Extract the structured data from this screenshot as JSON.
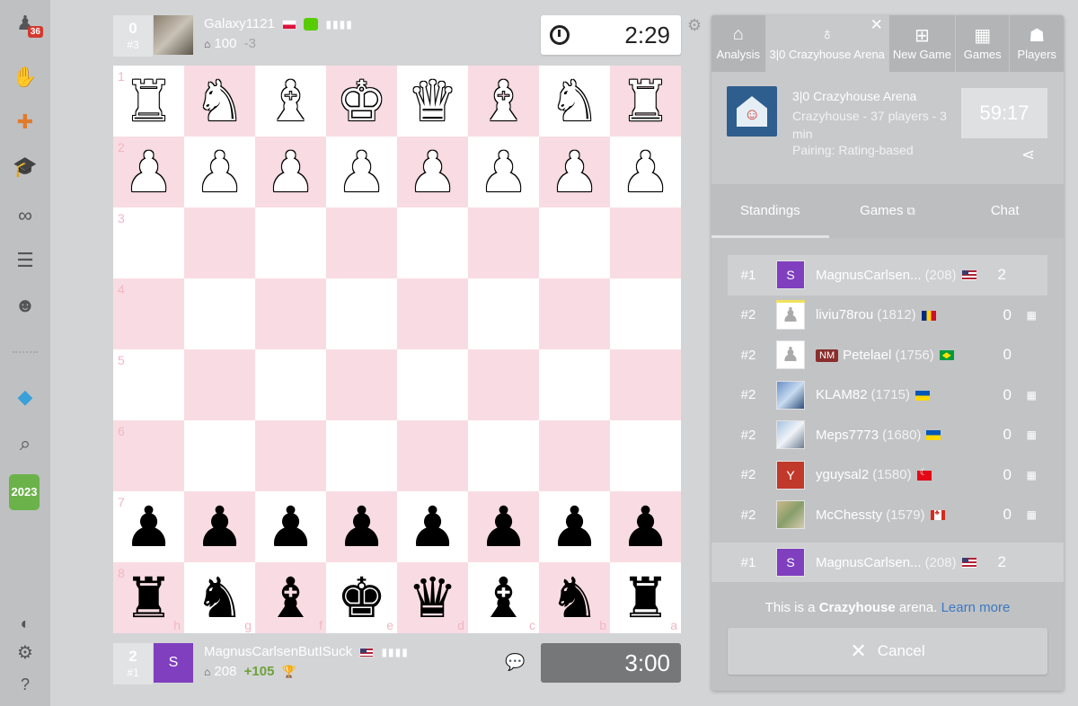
{
  "nav": {
    "badge": "36",
    "year_icon_text": "2023"
  },
  "top_player": {
    "points": "0",
    "rank": "#3",
    "name": "Galaxy1121",
    "rating": "100",
    "delta": "-3",
    "clock": "2:29"
  },
  "bottom_player": {
    "points": "2",
    "rank": "#1",
    "avatar_letter": "S",
    "name": "MagnusCarlsenButISuck",
    "rating": "208",
    "delta": "+105",
    "clock": "3:00"
  },
  "board": {
    "ranks": [
      "1",
      "2",
      "3",
      "4",
      "5",
      "6",
      "7",
      "8"
    ],
    "files": [
      "h",
      "g",
      "f",
      "e",
      "d",
      "c",
      "b",
      "a"
    ],
    "rows": [
      [
        "wR",
        "wN",
        "wB",
        "wK",
        "wQ",
        "wB",
        "wN",
        "wR"
      ],
      [
        "wP",
        "wP",
        "wP",
        "wP",
        "wP",
        "wP",
        "wP",
        "wP"
      ],
      [
        "",
        "",
        "",
        "",
        "",
        "",
        "",
        ""
      ],
      [
        "",
        "",
        "",
        "",
        "",
        "",
        "",
        ""
      ],
      [
        "",
        "",
        "",
        "",
        "",
        "",
        "",
        ""
      ],
      [
        "",
        "",
        "",
        "",
        "",
        "",
        "",
        ""
      ],
      [
        "bP",
        "bP",
        "bP",
        "bP",
        "bP",
        "bP",
        "bP",
        "bP"
      ],
      [
        "bR",
        "bN",
        "bB",
        "bK",
        "bQ",
        "bB",
        "bN",
        "bR"
      ]
    ]
  },
  "tabs": [
    {
      "label": "Analysis",
      "icon": "analysis-icon"
    },
    {
      "label": "3|0 Crazyhouse Arena",
      "icon": "tournament-icon"
    },
    {
      "label": "New Game",
      "icon": "plus-icon"
    },
    {
      "label": "Games",
      "icon": "games-icon"
    },
    {
      "label": "Players",
      "icon": "players-icon"
    }
  ],
  "tournament": {
    "name": "3|0 Crazyhouse Arena",
    "desc": "Crazyhouse - 37 players - 3 min",
    "pairing": "Pairing: Rating-based",
    "timer": "59:17"
  },
  "subtabs": {
    "standings": "Standings",
    "games": "Games",
    "chat": "Chat"
  },
  "standings": [
    {
      "rank": "#1",
      "avatar": "S",
      "avatar_type": "s",
      "title": "",
      "name": "MagnusCarlsen...",
      "rating": "(208)",
      "flag": "us",
      "score": "2",
      "stat": ""
    },
    {
      "rank": "#2",
      "avatar": "♟",
      "avatar_type": "pawn",
      "title": "",
      "name": "liviu78rou",
      "rating": "(1812)",
      "flag": "ro",
      "score": "0",
      "stat": "▦"
    },
    {
      "rank": "#2",
      "avatar": "♟",
      "avatar_type": "pawn",
      "title": "NM",
      "name": "Petelael",
      "rating": "(1756)",
      "flag": "br",
      "score": "0",
      "stat": ""
    },
    {
      "rank": "#2",
      "avatar": "",
      "avatar_type": "photo1",
      "title": "",
      "name": "KLAM82",
      "rating": "(1715)",
      "flag": "ua",
      "score": "0",
      "stat": "▦"
    },
    {
      "rank": "#2",
      "avatar": "",
      "avatar_type": "photo2",
      "title": "",
      "name": "Meps7773",
      "rating": "(1680)",
      "flag": "ua",
      "score": "0",
      "stat": "▦"
    },
    {
      "rank": "#2",
      "avatar": "Y",
      "avatar_type": "y",
      "title": "",
      "name": "yguysal2",
      "rating": "(1580)",
      "flag": "tr",
      "score": "0",
      "stat": "▦"
    },
    {
      "rank": "#2",
      "avatar": "",
      "avatar_type": "photo3",
      "title": "",
      "name": "McChessty",
      "rating": "(1579)",
      "flag": "ca",
      "score": "0",
      "stat": "▦"
    }
  ],
  "me_row": {
    "rank": "#1",
    "avatar": "S",
    "name": "MagnusCarlsen...",
    "rating": "(208)",
    "score": "2"
  },
  "footer": {
    "text_pre": "This is a ",
    "text_bold": "Crazyhouse",
    "text_post": " arena. ",
    "learn_more": "Learn more",
    "cancel": "Cancel"
  }
}
